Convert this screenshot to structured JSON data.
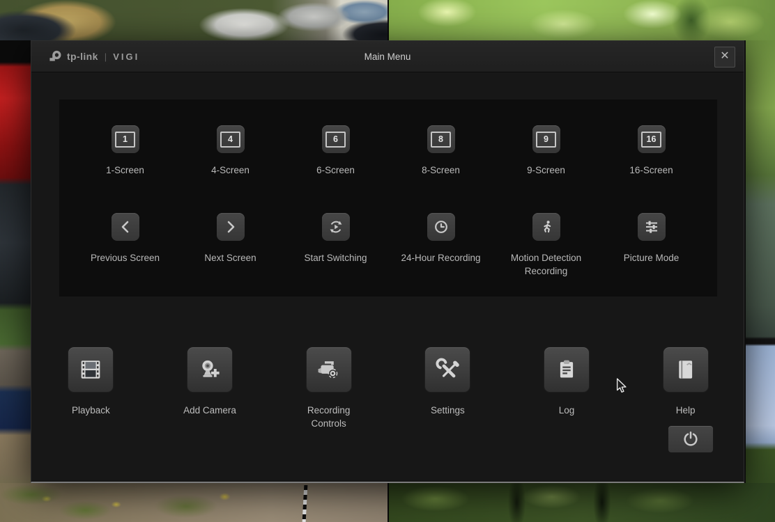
{
  "window": {
    "brand": "tp-link",
    "brand_divider": "|",
    "brand_sub": "VIGI",
    "title": "Main Menu",
    "close_icon": "✕"
  },
  "screen_modes": [
    {
      "num": "1",
      "label": "1-Screen",
      "icon": "screen-1-icon"
    },
    {
      "num": "4",
      "label": "4-Screen",
      "icon": "screen-4-icon"
    },
    {
      "num": "6",
      "label": "6-Screen",
      "icon": "screen-6-icon"
    },
    {
      "num": "8",
      "label": "8-Screen",
      "icon": "screen-8-icon"
    },
    {
      "num": "9",
      "label": "9-Screen",
      "icon": "screen-9-icon"
    },
    {
      "num": "16",
      "label": "16-Screen",
      "icon": "screen-16-icon"
    }
  ],
  "view_controls": [
    {
      "label": "Previous Screen",
      "icon": "chevron-left-icon"
    },
    {
      "label": "Next Screen",
      "icon": "chevron-right-icon"
    },
    {
      "label": "Start Switching",
      "icon": "switch-play-icon"
    },
    {
      "label": "24-Hour Recording",
      "icon": "clock-icon"
    },
    {
      "label": "Motion Detection Recording",
      "icon": "running-person-icon"
    },
    {
      "label": "Picture Mode",
      "icon": "sliders-icon"
    }
  ],
  "main_actions": [
    {
      "label": "Playback",
      "icon": "film-icon"
    },
    {
      "label": "Add Camera",
      "icon": "camera-plus-icon"
    },
    {
      "label": "Recording Controls",
      "icon": "camcorder-gear-icon"
    },
    {
      "label": "Settings",
      "icon": "tools-icon"
    },
    {
      "label": "Log",
      "icon": "clipboard-icon"
    },
    {
      "label": "Help",
      "icon": "book-icon"
    }
  ],
  "power": {
    "icon": "power-icon"
  },
  "colors": {
    "dialog_bg": "#171717",
    "header_bg": "#242424",
    "panel_bg": "#0d0d0d",
    "button_bg": "#3d3d3d",
    "label_text": "#b9b9b9",
    "title_text": "#cfcfcf"
  }
}
